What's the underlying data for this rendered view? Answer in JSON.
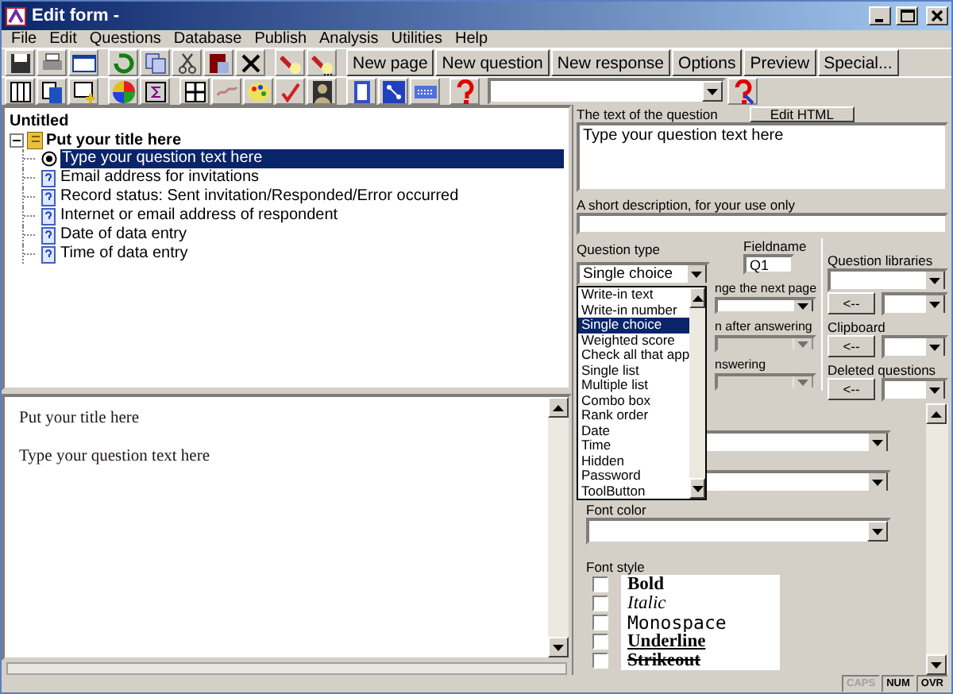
{
  "window": {
    "title": "Edit form -"
  },
  "menu": [
    "File",
    "Edit",
    "Questions",
    "Database",
    "Publish",
    "Analysis",
    "Utilities",
    "Help"
  ],
  "toolbar_buttons": [
    "New page",
    "New question",
    "New response",
    "Options",
    "Preview",
    "Special..."
  ],
  "tree": {
    "root": "Untitled",
    "children": [
      {
        "label": "Put your title here",
        "expanded": true,
        "children": [
          {
            "label": "Type your question text here",
            "kind": "radio",
            "selected": true
          },
          {
            "label": "Email address for invitations",
            "kind": "question",
            "selected": false
          },
          {
            "label": "Record status: Sent invitation/Responded/Error occurred",
            "kind": "question",
            "selected": false
          },
          {
            "label": "Internet or email address of respondent",
            "kind": "question",
            "selected": false
          },
          {
            "label": "Date of data entry",
            "kind": "question",
            "selected": false
          },
          {
            "label": "Time of data entry",
            "kind": "question",
            "selected": false
          }
        ]
      }
    ]
  },
  "preview": {
    "title": "Put your title here",
    "question": "Type your question text here"
  },
  "question_panel": {
    "text_label": "The text of the question",
    "edit_html_button": "Edit HTML",
    "text_value": "Type your question text here",
    "description_label": "A short description, for your use only",
    "question_type_label": "Question type",
    "question_type_value": "Single choice",
    "fieldname_label": "Fieldname",
    "fieldname_value": "Q1",
    "partial_labels": [
      {
        "label": "nge the next page",
        "disabled": false
      },
      {
        "label": "n after answering",
        "disabled": true
      },
      {
        "label": "nswering",
        "disabled": true
      }
    ],
    "libraries": [
      {
        "label": "Question libraries"
      },
      {
        "back_button": "<--"
      },
      {
        "label": "Clipboard",
        "back_button": "<--"
      },
      {
        "label": "Deleted questions",
        "back_button": "<--"
      }
    ],
    "dropdown_options": [
      {
        "label": "Write-in text",
        "selected": false
      },
      {
        "label": "Write-in number",
        "selected": false
      },
      {
        "label": "Single choice",
        "selected": true
      },
      {
        "label": "Weighted score",
        "selected": false
      },
      {
        "label": "Check all that app",
        "selected": false
      },
      {
        "label": "Single list",
        "selected": false
      },
      {
        "label": "Multiple list",
        "selected": false
      },
      {
        "label": "Combo box",
        "selected": false
      },
      {
        "label": "Rank order",
        "selected": false
      },
      {
        "label": "Date",
        "selected": false
      },
      {
        "label": "Time",
        "selected": false
      },
      {
        "label": "Hidden",
        "selected": false
      },
      {
        "label": "Password",
        "selected": false
      },
      {
        "label": "ToolButton",
        "selected": false
      }
    ],
    "font_color_label": "Font color",
    "font_style_label": "Font style",
    "font_styles": [
      {
        "label": "Bold",
        "kind": "bold",
        "checked": false
      },
      {
        "label": "Italic",
        "kind": "italic",
        "checked": false
      },
      {
        "label": "Monospace",
        "kind": "monospace",
        "checked": false
      },
      {
        "label": "Underline",
        "kind": "underline",
        "checked": false
      },
      {
        "label": "Strikeout",
        "kind": "strikeout",
        "checked": false
      }
    ]
  },
  "status_bar": [
    {
      "label": "CAPS",
      "active": false
    },
    {
      "label": "NUM",
      "active": true
    },
    {
      "label": "OVR",
      "active": true
    }
  ]
}
